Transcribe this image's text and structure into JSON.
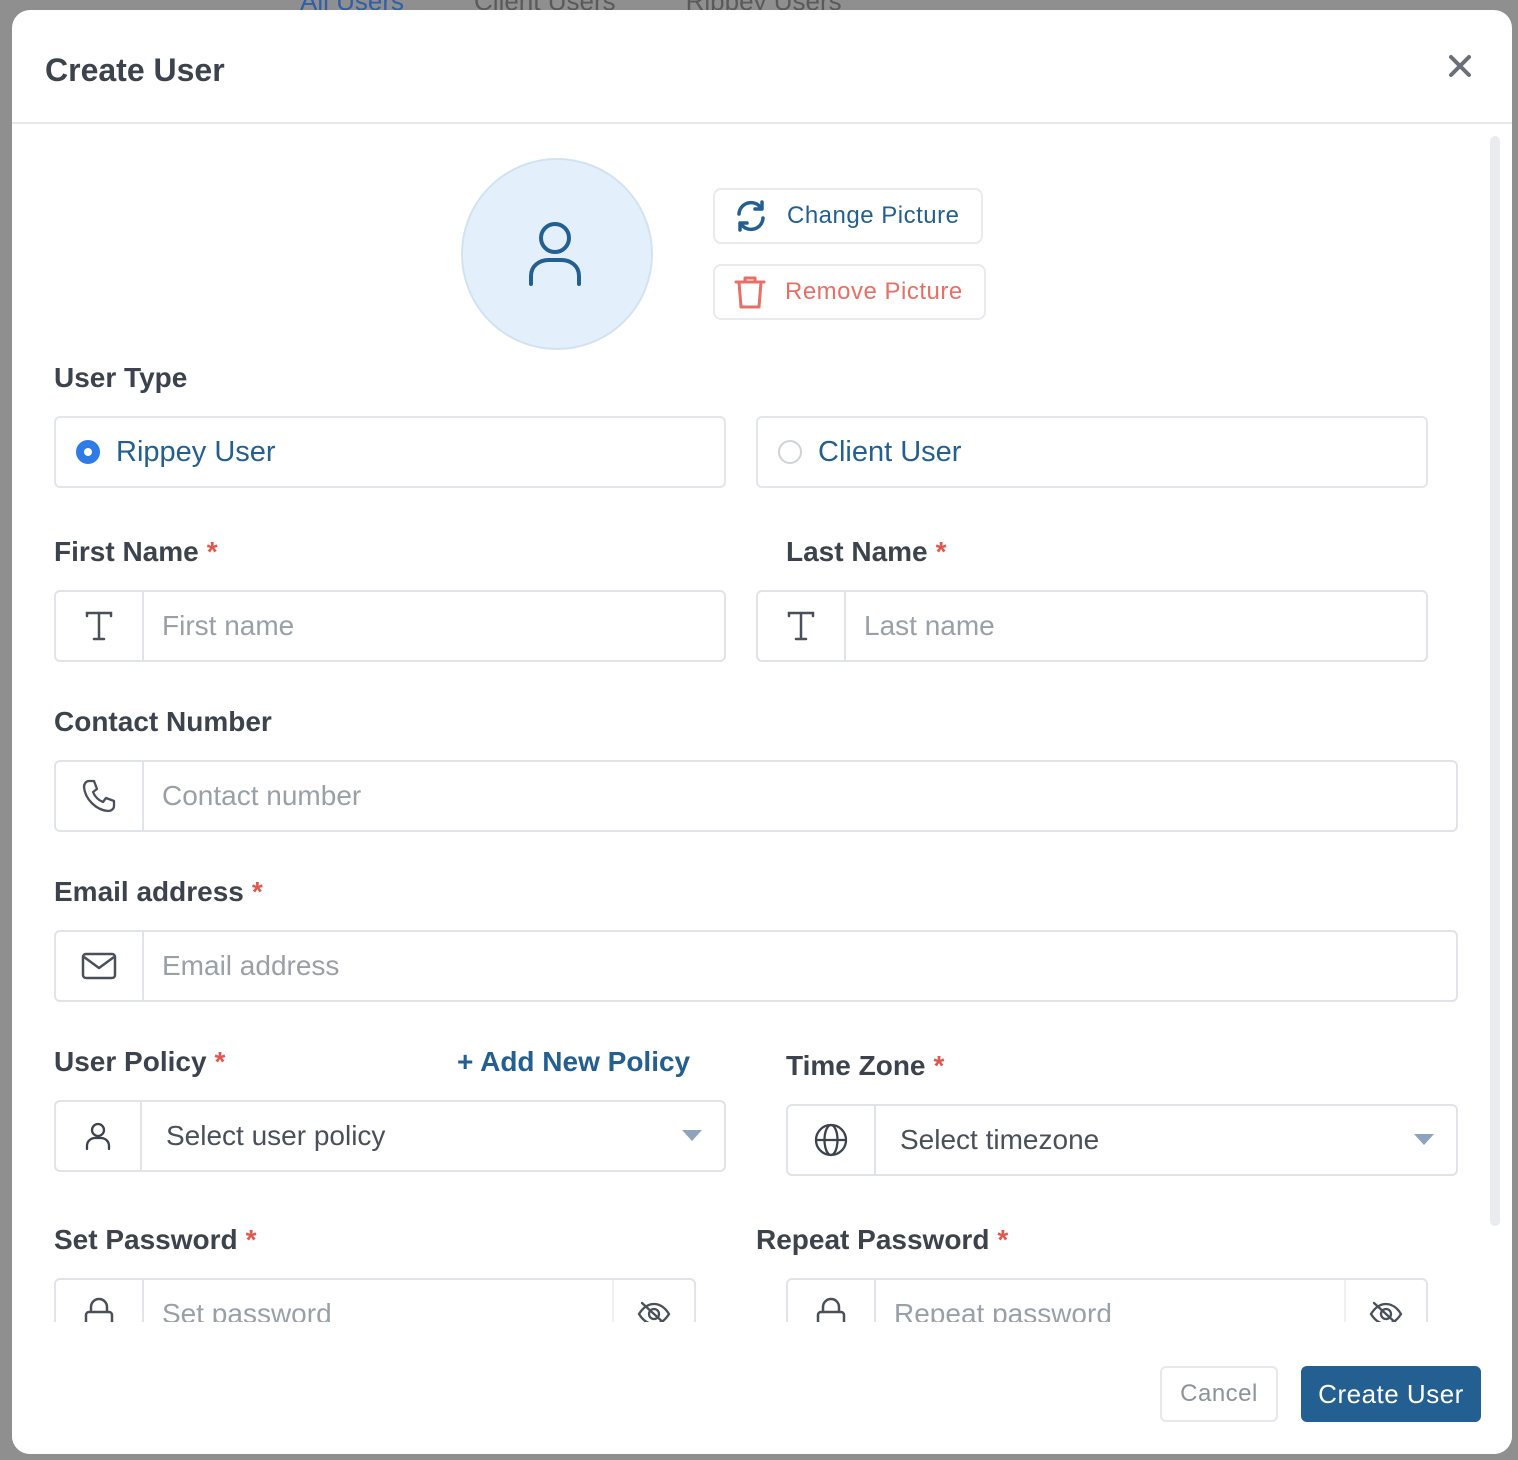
{
  "background": {
    "tabs": [
      "All Users",
      "Client Users",
      "Rippey Users"
    ]
  },
  "modal": {
    "title": "Create User",
    "close_icon": "close-icon"
  },
  "picture": {
    "change_label": "Change Picture",
    "remove_label": "Remove Picture"
  },
  "user_type": {
    "label": "User Type",
    "options": [
      {
        "label": "Rippey User",
        "selected": true
      },
      {
        "label": "Client User",
        "selected": false
      }
    ]
  },
  "first_name": {
    "label": "First Name",
    "required": "*",
    "placeholder": "First name"
  },
  "last_name": {
    "label": "Last Name",
    "required": "*",
    "placeholder": "Last name"
  },
  "contact": {
    "label": "Contact Number",
    "placeholder": "Contact number"
  },
  "email": {
    "label": "Email address",
    "required": "*",
    "placeholder": "Email address"
  },
  "user_policy": {
    "label": "User Policy",
    "required": "*",
    "add_link": "+ Add New Policy",
    "placeholder": "Select user policy"
  },
  "time_zone": {
    "label": "Time Zone",
    "required": "*",
    "placeholder": "Select timezone"
  },
  "set_password": {
    "label": "Set Password",
    "required": "*",
    "placeholder": "Set password"
  },
  "repeat_password": {
    "label": "Repeat Password",
    "required": "*",
    "placeholder": "Repeat password"
  },
  "footer": {
    "cancel_label": "Cancel",
    "create_label": "Create User"
  },
  "colors": {
    "primary": "#245f92",
    "danger": "#e86f66",
    "radio": "#2f7be8",
    "required": "#e2574c"
  }
}
